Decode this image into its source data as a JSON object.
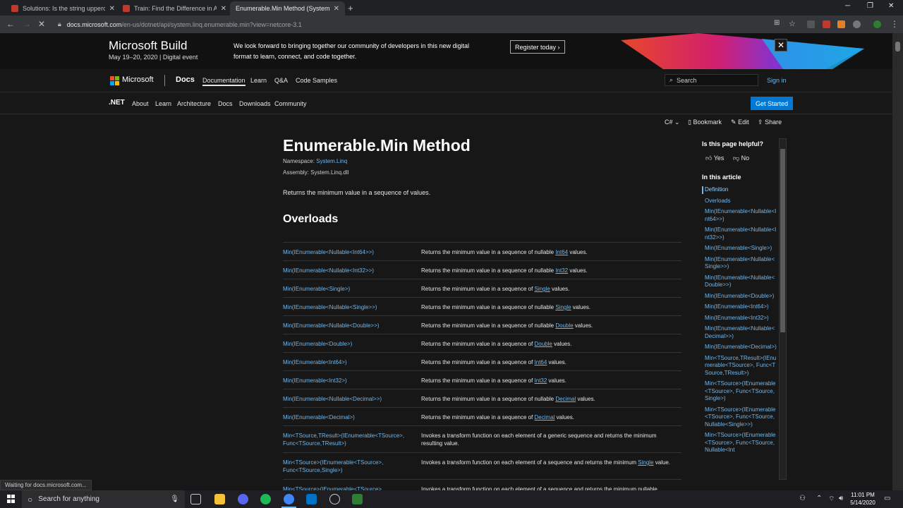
{
  "browser": {
    "tabs": [
      {
        "title": "Solutions: Is the string uppercase?",
        "color": "#c0392b",
        "active": false
      },
      {
        "title": "Train: Find the Difference in Age",
        "color": "#c0392b",
        "active": false
      },
      {
        "title": "Enumerable.Min Method (System...",
        "color": "#e8eaed",
        "active": true
      }
    ],
    "url_host": "docs.microsoft.com",
    "url_path": "/en-us/dotnet/api/system.linq.enumerable.min?view=netcore-3.1",
    "status": "Waiting for docs.microsoft.com..."
  },
  "banner": {
    "title": "Microsoft Build",
    "subtitle": "May 19–20, 2020 | Digital event",
    "text": "We look forward to bringing together our community of developers in this new digital format to learn, connect, and code together.",
    "button": "Register today",
    "close": "✕"
  },
  "header": {
    "brand": "Microsoft",
    "docs": "Docs",
    "links": [
      "Documentation",
      "Learn",
      "Q&A",
      "Code Samples"
    ],
    "search_placeholder": "Search",
    "signin": "Sign in"
  },
  "subnav": {
    "brand": ".NET",
    "links": [
      "About",
      "Learn",
      "Architecture",
      "Docs",
      "Downloads",
      "Community"
    ],
    "cta": "Get Started"
  },
  "actions": {
    "language": "C#",
    "bookmark": "Bookmark",
    "edit": "Edit",
    "share": "Share"
  },
  "article": {
    "title": "Enumerable.Min Method",
    "namespace_label": "Namespace:",
    "namespace": "System.Linq",
    "assembly_label": "Assembly:",
    "assembly": "System.Linq.dll",
    "summary": "Returns the minimum value in a sequence of values.",
    "overloads_heading": "Overloads",
    "overloads": [
      {
        "name": "Min(IEnumerable<Nullable<Int64>>)",
        "pre": "Returns the minimum value in a sequence of nullable ",
        "link": "Int64",
        "post": " values."
      },
      {
        "name": "Min(IEnumerable<Nullable<Int32>>)",
        "pre": "Returns the minimum value in a sequence of nullable ",
        "link": "Int32",
        "post": " values."
      },
      {
        "name": "Min(IEnumerable<Single>)",
        "pre": "Returns the minimum value in a sequence of ",
        "link": "Single",
        "post": " values."
      },
      {
        "name": "Min(IEnumerable<Nullable<Single>>)",
        "pre": "Returns the minimum value in a sequence of nullable ",
        "link": "Single",
        "post": " values."
      },
      {
        "name": "Min(IEnumerable<Nullable<Double>>)",
        "pre": "Returns the minimum value in a sequence of nullable ",
        "link": "Double",
        "post": " values."
      },
      {
        "name": "Min(IEnumerable<Double>)",
        "pre": "Returns the minimum value in a sequence of ",
        "link": "Double",
        "post": " values."
      },
      {
        "name": "Min(IEnumerable<Int64>)",
        "pre": "Returns the minimum value in a sequence of ",
        "link": "Int64",
        "post": " values."
      },
      {
        "name": "Min(IEnumerable<Int32>)",
        "pre": "Returns the minimum value in a sequence of ",
        "link": "Int32",
        "post": " values."
      },
      {
        "name": "Min(IEnumerable<Nullable<Decimal>>)",
        "pre": "Returns the minimum value in a sequence of nullable ",
        "link": "Decimal",
        "post": " values."
      },
      {
        "name": "Min(IEnumerable<Decimal>)",
        "pre": "Returns the minimum value in a sequence of ",
        "link": "Decimal",
        "post": " values."
      },
      {
        "name": "Min<TSource,TResult>(IEnumerable<TSource>, Func<TSource,TResult>)",
        "pre": "Invokes a transform function on each element of a generic sequence and returns the minimum resulting value.",
        "link": "",
        "post": ""
      },
      {
        "name": "Min<TSource>(IEnumerable<TSource>, Func<TSource,Single>)",
        "pre": "Invokes a transform function on each element of a sequence and returns the minimum ",
        "link": "Single",
        "post": " value."
      },
      {
        "name": "Min<TSource>(IEnumerable<TSource>...",
        "pre": "Invokes a transform function on each element of a sequence and returns the minimum nullable",
        "link": "",
        "post": ""
      }
    ]
  },
  "rail": {
    "helpful": "Is this page helpful?",
    "yes": "Yes",
    "no": "No",
    "in_article": "In this article",
    "toc": [
      "Definition",
      "Overloads",
      "Min(IEnumerable<Nullable<Int64>>)",
      "Min(IEnumerable<Nullable<Int32>>)",
      "Min(IEnumerable<Single>)",
      "Min(IEnumerable<Nullable<Single>>)",
      "Min(IEnumerable<Nullable<Double>>)",
      "Min(IEnumerable<Double>)",
      "Min(IEnumerable<Int64>)",
      "Min(IEnumerable<Int32>)",
      "Min(IEnumerable<Nullable<Decimal>>)",
      "Min(IEnumerable<Decimal>)",
      "Min<TSource,TResult>(IEnumerable<TSource>, Func<TSource,TResult>)",
      "Min<TSource>(IEnumerable<TSource>, Func<TSource,Single>)",
      "Min<TSource>(IEnumerable<TSource>, Func<TSource,Nullable<Single>>)",
      "Min<TSource>(IEnumerable<TSource>, Func<TSource,Nullable<Int"
    ]
  },
  "taskbar": {
    "search_placeholder": "Search for anything",
    "time": "11:01 PM",
    "date": "5/14/2020"
  },
  "colors": {
    "link": "#75b6e7",
    "accent": "#0078d4",
    "background": "#171717"
  }
}
